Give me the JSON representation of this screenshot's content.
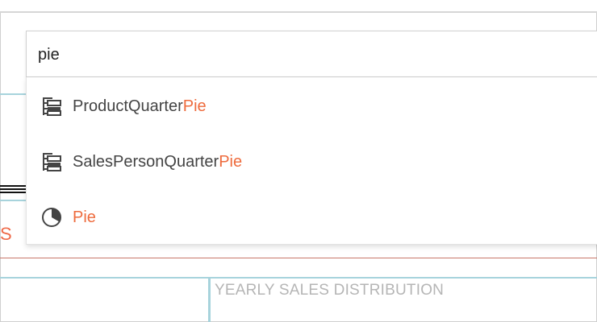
{
  "search": {
    "value": "pie"
  },
  "results": [
    {
      "prefix": "ProductQuarter",
      "match": "Pie",
      "icon": "hierarchy-icon"
    },
    {
      "prefix": "SalesPersonQuarter",
      "match": "Pie",
      "icon": "hierarchy-icon"
    },
    {
      "prefix": "",
      "match": "Pie",
      "icon": "pie-chart-icon"
    }
  ],
  "background": {
    "panel_title": "YEARLY SALES DISTRIBUTION",
    "partial_glyph": "S"
  },
  "colors": {
    "highlight": "#ee6b3d",
    "text": "#444444",
    "teal_divider": "#a7d3dc",
    "red_divider": "#c8776a",
    "muted_title": "#b5b5b5"
  }
}
